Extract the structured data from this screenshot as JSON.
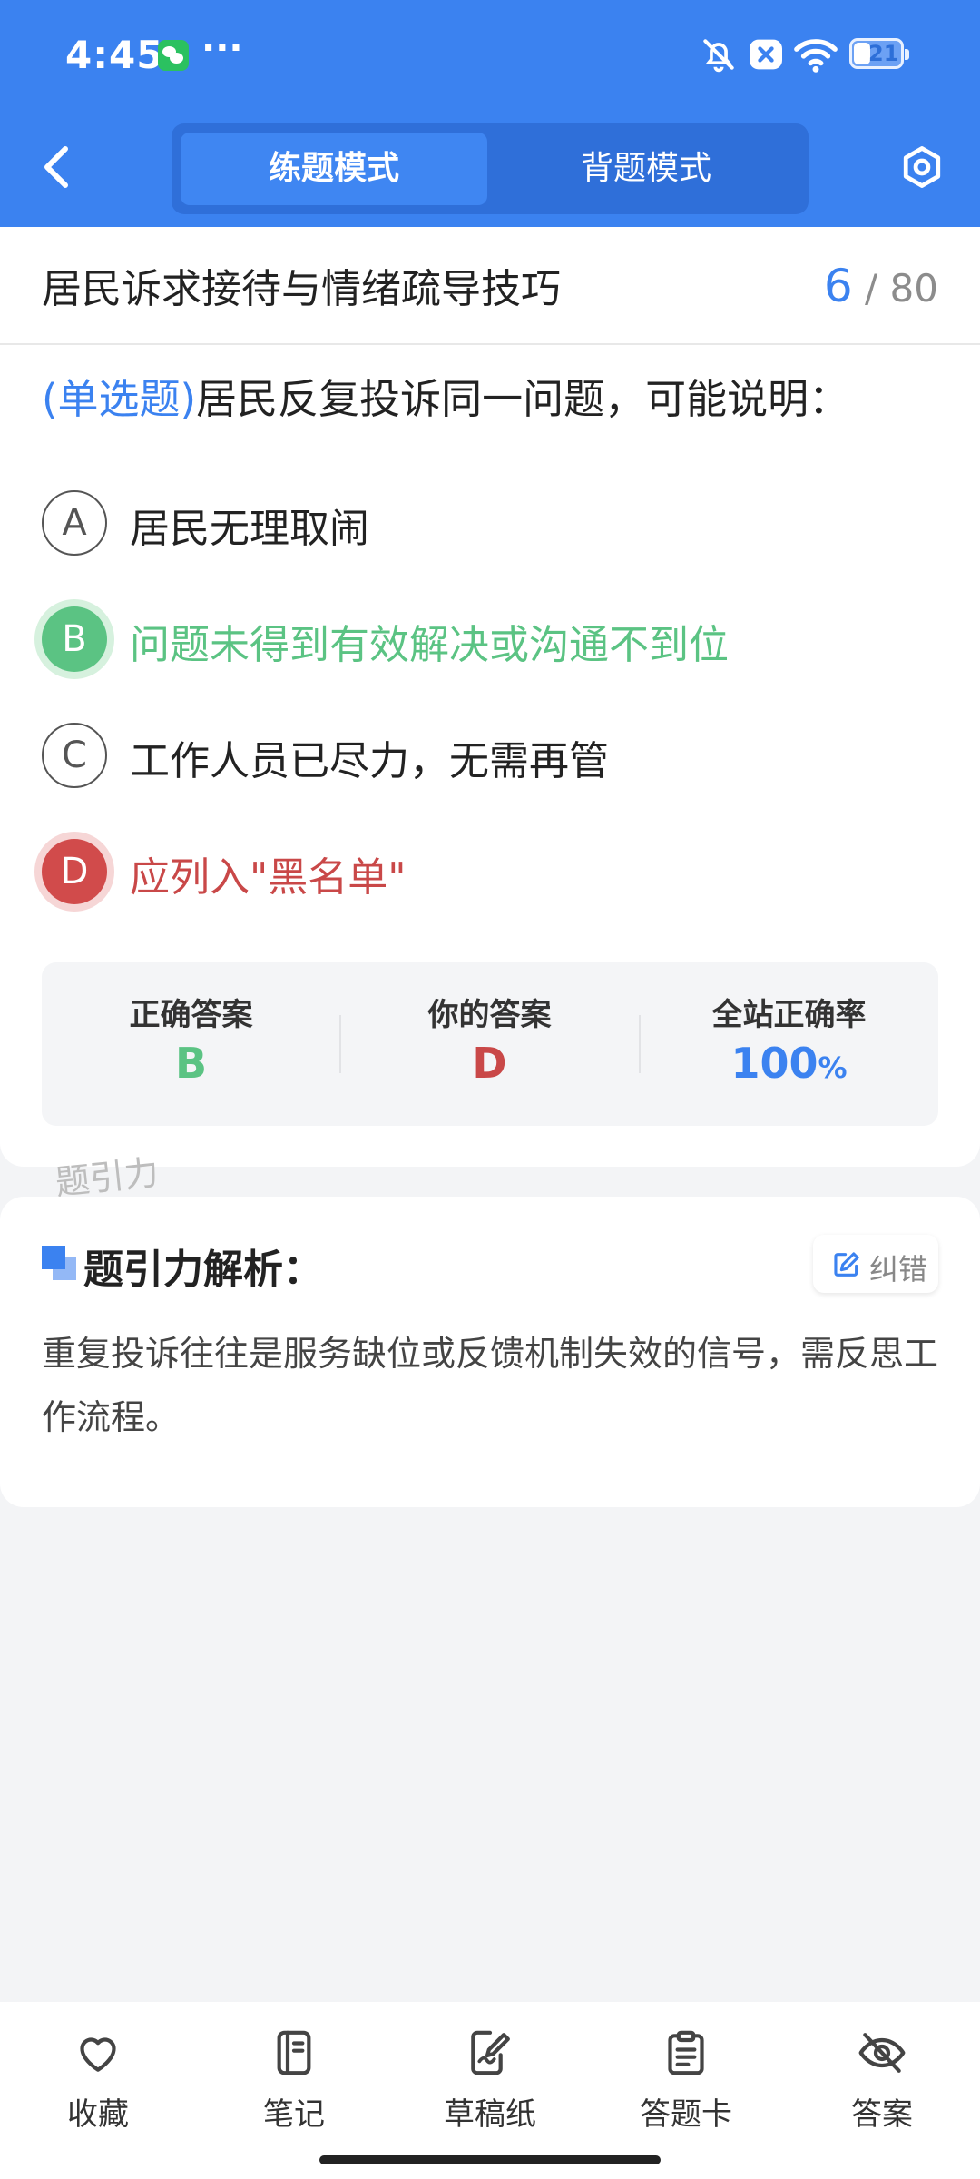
{
  "status_bar": {
    "time": "4:45",
    "battery": "21"
  },
  "header": {
    "tabs": [
      {
        "label": "练题模式",
        "active": true
      },
      {
        "label": "背题模式",
        "active": false
      }
    ]
  },
  "quiz": {
    "category": "居民诉求接待与情绪疏导技巧",
    "current": "6",
    "separator": "/",
    "total": "80",
    "question_type": "(单选题)",
    "question_text": "居民反复投诉同一问题，可能说明：",
    "options": [
      {
        "letter": "A",
        "text": "居民无理取闹",
        "state": "normal"
      },
      {
        "letter": "B",
        "text": "问题未得到有效解决或沟通不到位",
        "state": "correct"
      },
      {
        "letter": "C",
        "text": "工作人员已尽力，无需再管",
        "state": "normal"
      },
      {
        "letter": "D",
        "text": "应列入\"黑名单\"",
        "state": "wrong"
      }
    ],
    "summary": {
      "correct_label": "正确答案",
      "correct_value": "B",
      "yours_label": "你的答案",
      "yours_value": "D",
      "rate_label": "全站正确率",
      "rate_value": "100",
      "rate_unit": "%"
    },
    "watermark": "题引力"
  },
  "analysis": {
    "title": "题引力解析：",
    "fix_label": "纠错",
    "text": "重复投诉往往是服务缺位或反馈机制失效的信号，需反思工作流程。"
  },
  "bottom_nav": [
    {
      "label": "收藏",
      "icon": "heart-icon"
    },
    {
      "label": "笔记",
      "icon": "notebook-icon"
    },
    {
      "label": "草稿纸",
      "icon": "draft-icon"
    },
    {
      "label": "答题卡",
      "icon": "clipboard-icon"
    },
    {
      "label": "答案",
      "icon": "eye-off-icon"
    }
  ],
  "colors": {
    "primary": "#3B82F0",
    "correct": "#5BC383",
    "wrong": "#C94848"
  }
}
